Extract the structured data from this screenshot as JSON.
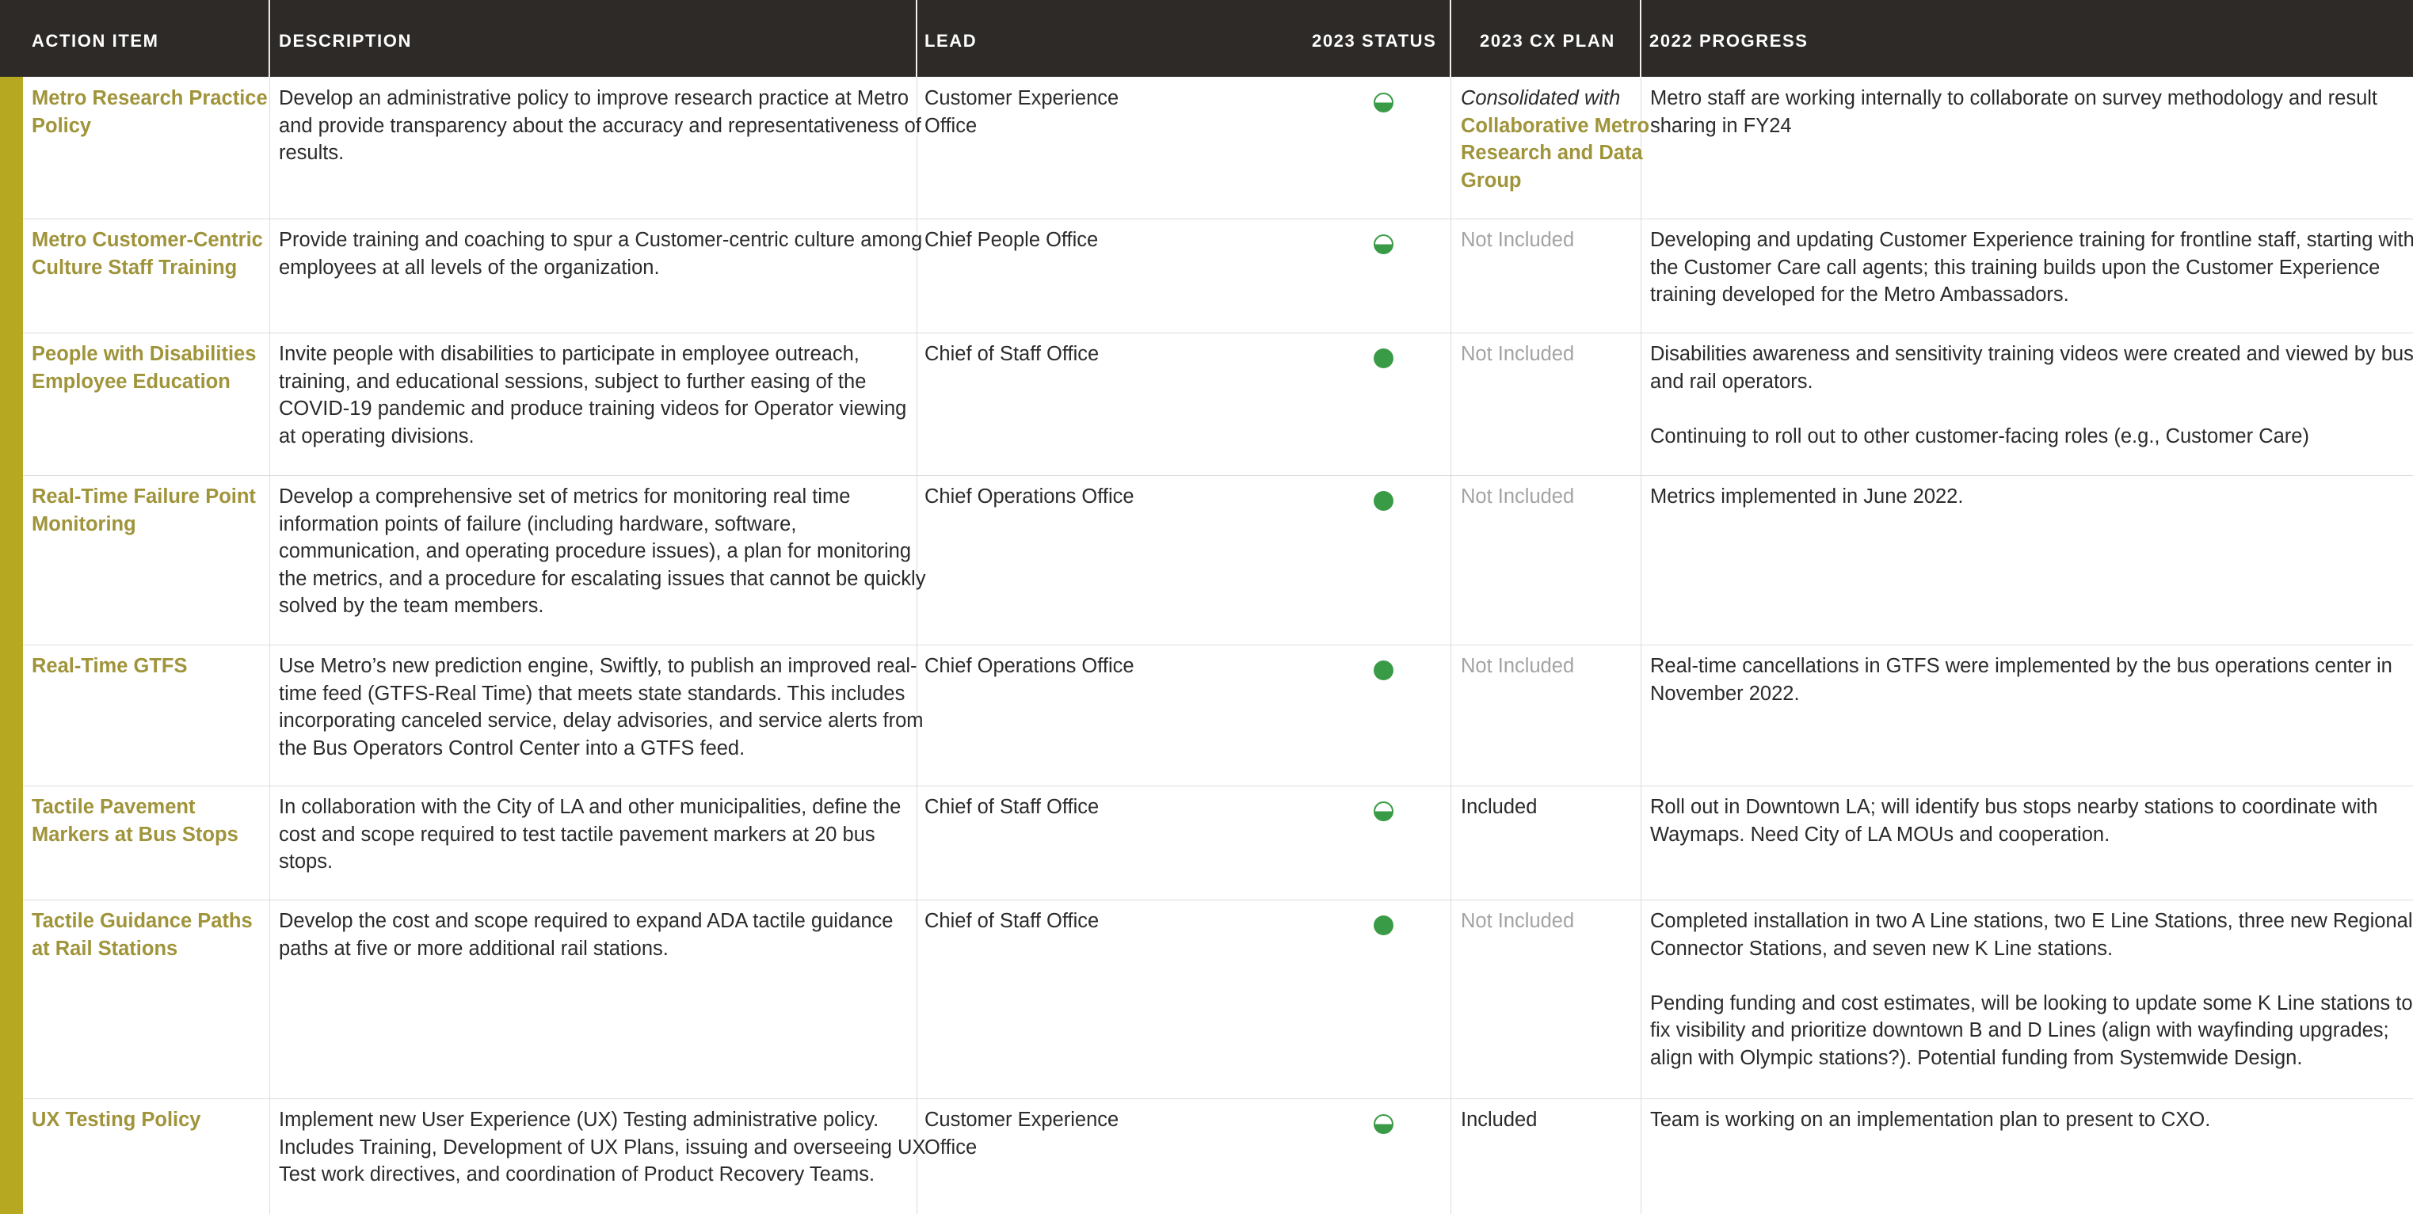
{
  "colors": {
    "header_bg": "#2d2a27",
    "header_text": "#ffffff",
    "accent": "#b6a921",
    "title_gold": "#a0943b",
    "status_green": "#3a9b47",
    "muted": "#a3a3a3"
  },
  "headers": {
    "action": "ACTION ITEM",
    "description": "DESCRIPTION",
    "lead": "LEAD",
    "status": "2023 STATUS",
    "plan": "2023 CX PLAN",
    "progress": "2022 PROGRESS"
  },
  "status_legend": {
    "full": "green filled circle icon",
    "half": "half-filled green circle icon"
  },
  "rows": [
    {
      "action": "Metro Research Practice Policy",
      "description": "Develop an administrative policy to improve research practice at Metro and provide transparency about the accuracy and representativeness of results.",
      "lead": "Customer Experience Office",
      "status": "half",
      "plan_prefix": "Consolidated with",
      "plan": "Collaborative Metro Research and Data Group",
      "progress": [
        "Metro staff are working internally to collaborate on survey methodology and result sharing in FY24"
      ]
    },
    {
      "action": "Metro Customer-Centric Culture Staff Training",
      "description": "Provide training and coaching to spur a Customer-centric culture among employees at all levels of the organization.",
      "lead": "Chief People Office",
      "status": "half",
      "plan": "Not Included",
      "progress": [
        "Developing and updating Customer Experience training for frontline staff, starting with the Customer Care call agents; this training builds upon the Customer Experience training developed for the Metro Ambassadors."
      ]
    },
    {
      "action": "People with Disabilities Employee Education",
      "description": "Invite people with disabilities to participate in employee outreach, training, and educational sessions, subject to further easing of the COVID-19 pandemic and produce training videos for Operator viewing at operating divisions.",
      "lead": "Chief of Staff Office",
      "status": "full",
      "plan": "Not Included",
      "progress": [
        "Disabilities awareness and sensitivity training videos were created and viewed by bus and rail operators.",
        "Continuing to roll out to other customer-facing roles (e.g., Customer Care)"
      ]
    },
    {
      "action": "Real-Time Failure Point Monitoring",
      "description": "Develop a comprehensive set of metrics for monitoring real time information  points of failure (including hardware, software, communication, and operating procedure issues), a plan for monitoring the metrics, and a procedure for escalating issues that cannot be quickly solved by the team members.",
      "lead": "Chief Operations Office",
      "status": "full",
      "plan": "Not Included",
      "progress": [
        "Metrics implemented in June 2022."
      ]
    },
    {
      "action": "Real-Time GTFS",
      "description": "Use Metro’s new prediction engine, Swiftly, to publish an improved real-time feed (GTFS-Real Time) that meets state standards. This includes incorporating canceled service, delay advisories, and service alerts from the Bus Operators Control Center into a GTFS feed.",
      "lead": "Chief Operations Office",
      "status": "full",
      "plan": "Not Included",
      "progress": [
        "Real-time cancellations in GTFS were implemented by the bus operations center in November 2022."
      ]
    },
    {
      "action": "Tactile Pavement Markers at Bus Stops",
      "description": "In collaboration with the City of LA and other municipalities, define the cost and scope required to test tactile pavement markers at 20 bus stops.",
      "lead": "Chief of Staff Office",
      "status": "half",
      "plan": "Included",
      "progress": [
        "Roll out in Downtown LA; will identify bus stops nearby stations to coordinate with Waymaps. Need City of LA MOUs and cooperation."
      ]
    },
    {
      "action": "Tactile Guidance Paths at Rail Stations",
      "description": "Develop the cost and scope required to expand ADA tactile guidance paths at five or more additional rail stations.",
      "lead": "Chief of Staff Office",
      "status": "full",
      "plan": "Not Included",
      "progress": [
        "Completed installation in two A Line stations, two E Line Stations, three new Regional Connector Stations, and seven new K Line stations.",
        "Pending funding and cost estimates, will be looking to update some K Line stations to fix visibility and prioritize downtown B and D Lines (align with wayfinding upgrades; align with Olympic stations?). Potential funding from Systemwide Design."
      ]
    },
    {
      "action": "UX Testing Policy",
      "description": "Implement new User Experience (UX) Testing administrative policy. Includes Training, Development of UX Plans, issuing and overseeing UX Test work directives, and coordination of Product Recovery Teams.",
      "lead": "Customer Experience Office",
      "status": "half",
      "plan": "Included",
      "progress": [
        "Team is working on an implementation plan to present to CXO."
      ]
    }
  ]
}
